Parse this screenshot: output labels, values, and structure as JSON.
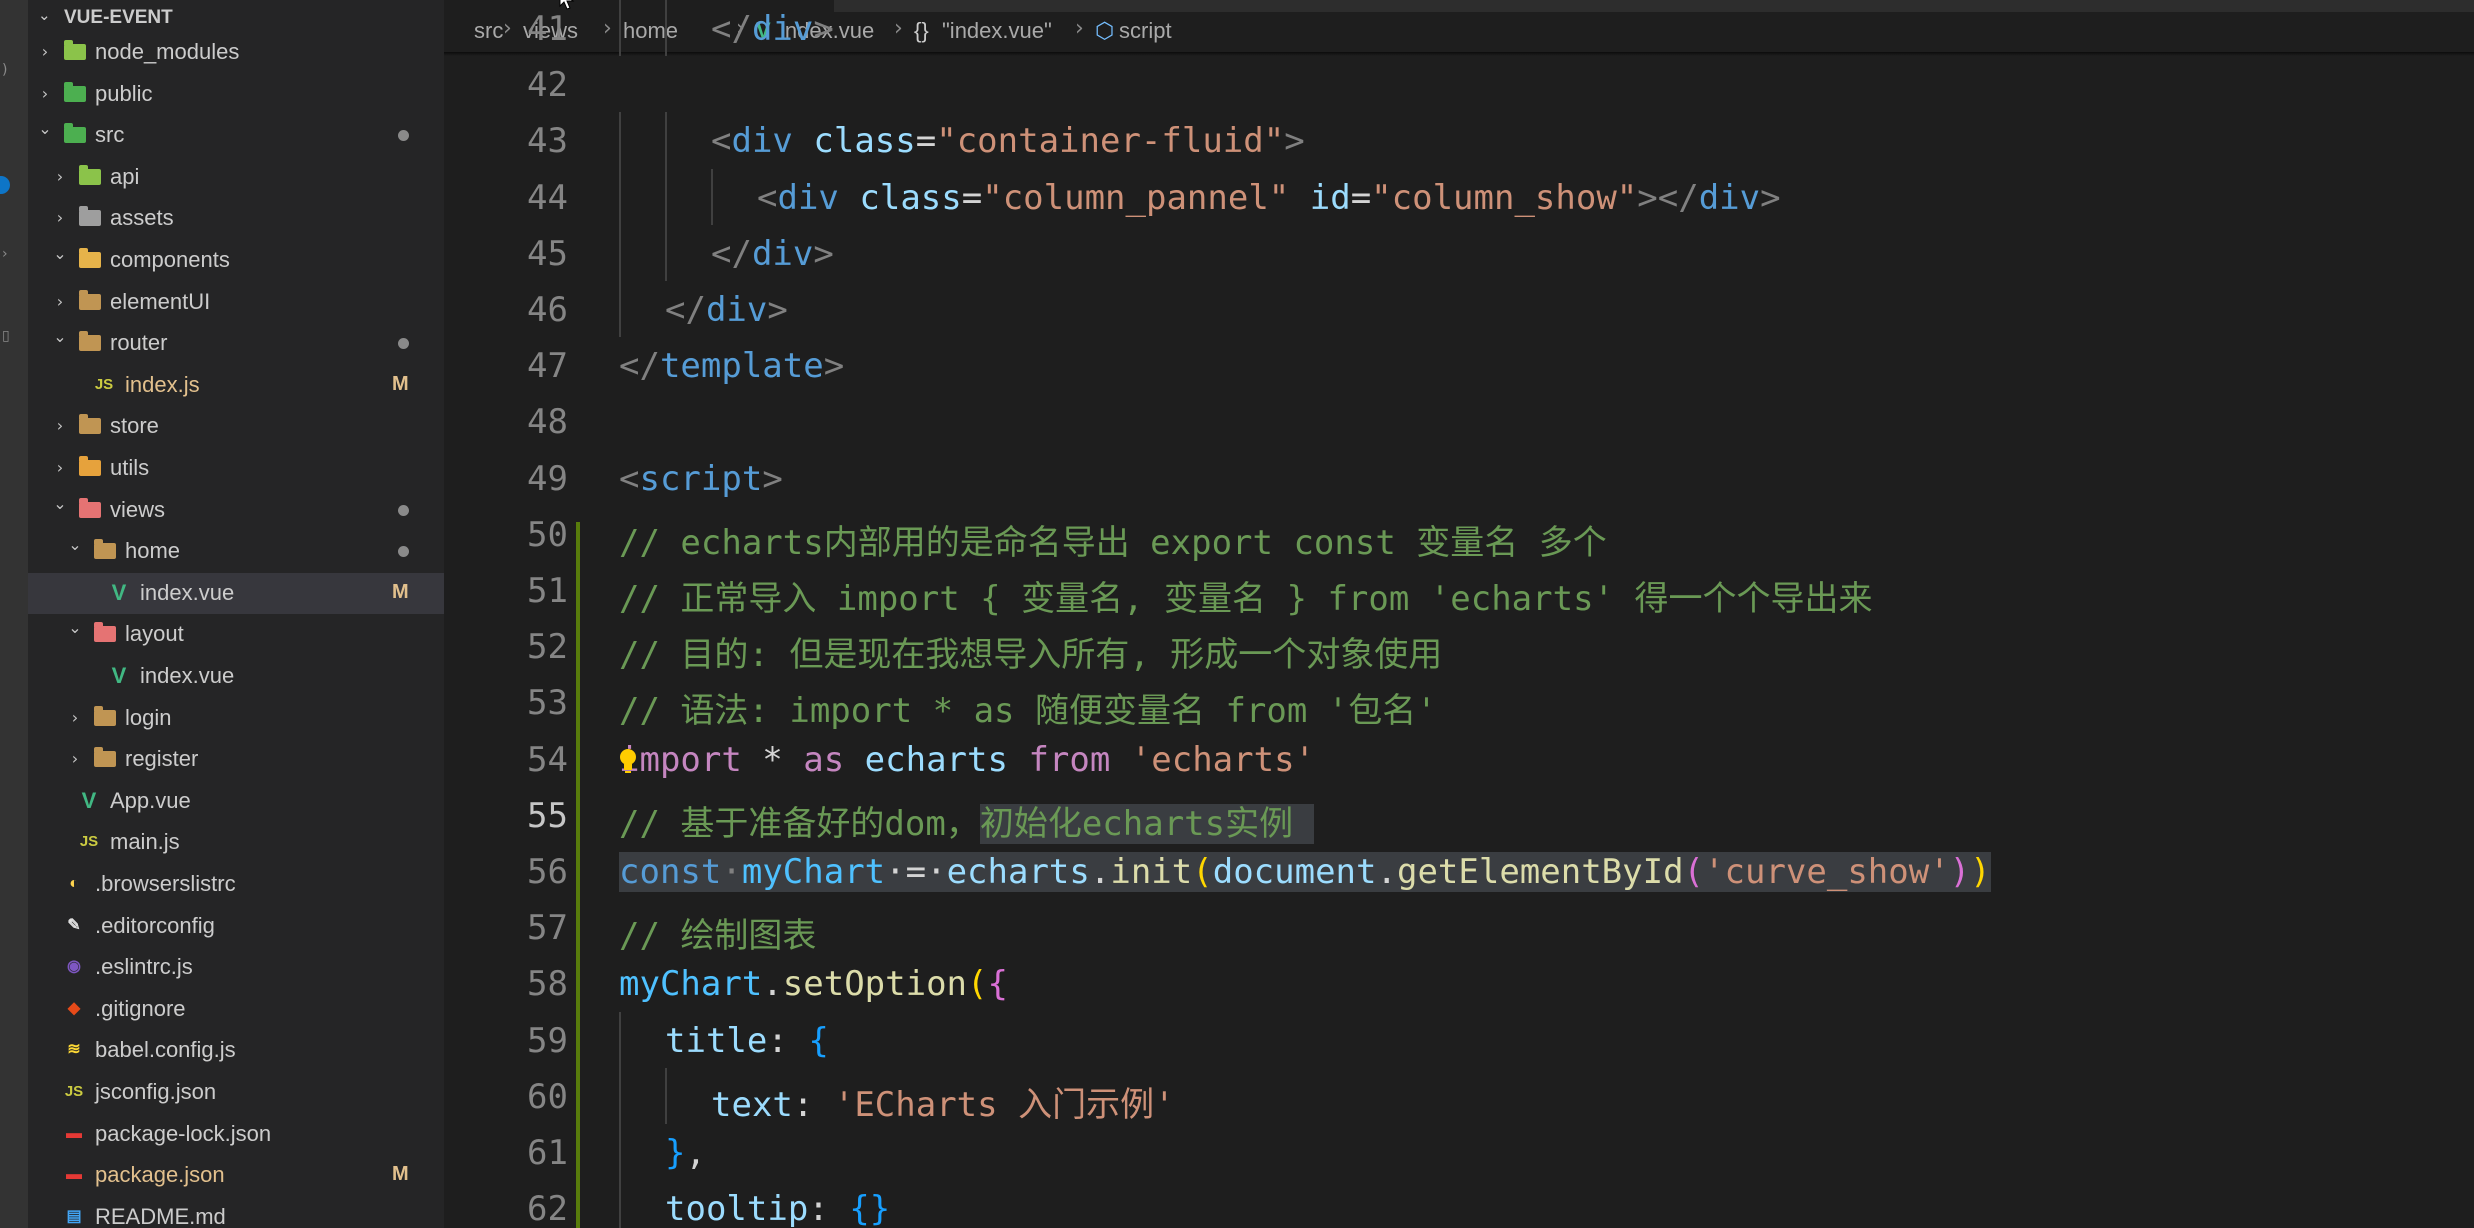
{
  "explorer": {
    "title": "VUE-EVENT",
    "items": [
      {
        "label": "node_modules",
        "depth": 1,
        "kind": "folder",
        "open": false,
        "icon": "node-folder-icon",
        "color": "#8bc34a"
      },
      {
        "label": "public",
        "depth": 1,
        "kind": "folder",
        "open": false,
        "icon": "public-folder-icon",
        "color": "#4caf50"
      },
      {
        "label": "src",
        "depth": 1,
        "kind": "folder",
        "open": true,
        "icon": "src-folder-icon",
        "color": "#4caf50",
        "badge": "dot"
      },
      {
        "label": "api",
        "depth": 2,
        "kind": "folder",
        "open": false,
        "icon": "api-folder-icon",
        "color": "#8bc34a"
      },
      {
        "label": "assets",
        "depth": 2,
        "kind": "folder",
        "open": false,
        "icon": "assets-folder-icon",
        "color": "#9e9e9e"
      },
      {
        "label": "components",
        "depth": 2,
        "kind": "folder",
        "open": true,
        "icon": "components-folder-icon",
        "color": "#e6b34a"
      },
      {
        "label": "elementUI",
        "depth": 2,
        "kind": "folder",
        "open": false,
        "icon": "folder-icon",
        "color": "#c09553"
      },
      {
        "label": "router",
        "depth": 2,
        "kind": "folder",
        "open": true,
        "icon": "router-folder-icon",
        "color": "#c09553",
        "badge": "dot"
      },
      {
        "label": "index.js",
        "depth": 3,
        "kind": "file",
        "icon": "js-file-icon",
        "glyph": "JS",
        "color": "#cbcb41",
        "badge": "M",
        "mod": true
      },
      {
        "label": "store",
        "depth": 2,
        "kind": "folder",
        "open": false,
        "icon": "folder-icon",
        "color": "#c09553"
      },
      {
        "label": "utils",
        "depth": 2,
        "kind": "folder",
        "open": false,
        "icon": "utils-folder-icon",
        "color": "#e6a23c"
      },
      {
        "label": "views",
        "depth": 2,
        "kind": "folder",
        "open": true,
        "icon": "views-folder-icon",
        "color": "#e57373",
        "badge": "dot"
      },
      {
        "label": "home",
        "depth": 3,
        "kind": "folder",
        "open": true,
        "icon": "folder-icon",
        "color": "#c09553",
        "badge": "dot"
      },
      {
        "label": "index.vue",
        "depth": 4,
        "kind": "file",
        "icon": "vue-file-icon",
        "glyph": "V",
        "color": "#41b883",
        "badge": "M",
        "selected": true
      },
      {
        "label": "layout",
        "depth": 3,
        "kind": "folder",
        "open": true,
        "icon": "layout-folder-icon",
        "color": "#e57373"
      },
      {
        "label": "index.vue",
        "depth": 4,
        "kind": "file",
        "icon": "vue-file-icon",
        "glyph": "V",
        "color": "#41b883"
      },
      {
        "label": "login",
        "depth": 3,
        "kind": "folder",
        "open": false,
        "icon": "folder-icon",
        "color": "#c09553"
      },
      {
        "label": "register",
        "depth": 3,
        "kind": "folder",
        "open": false,
        "icon": "folder-icon",
        "color": "#c09553"
      },
      {
        "label": "App.vue",
        "depth": 2,
        "kind": "file",
        "icon": "vue-file-icon",
        "glyph": "V",
        "color": "#41b883"
      },
      {
        "label": "main.js",
        "depth": 2,
        "kind": "file",
        "icon": "js-file-icon",
        "glyph": "JS",
        "color": "#cbcb41"
      },
      {
        "label": ".browserslistrc",
        "depth": 1,
        "kind": "file",
        "icon": "browserslist-file-icon",
        "glyph": "◐",
        "color": "#ffd54f"
      },
      {
        "label": ".editorconfig",
        "depth": 1,
        "kind": "file",
        "icon": "editorconfig-file-icon",
        "glyph": "✎",
        "color": "#e0e0e0"
      },
      {
        "label": ".eslintrc.js",
        "depth": 1,
        "kind": "file",
        "icon": "eslint-file-icon",
        "glyph": "◉",
        "color": "#7e57c2"
      },
      {
        "label": ".gitignore",
        "depth": 1,
        "kind": "file",
        "icon": "git-file-icon",
        "glyph": "◆",
        "color": "#e64a19"
      },
      {
        "label": "babel.config.js",
        "depth": 1,
        "kind": "file",
        "icon": "babel-file-icon",
        "glyph": "≋",
        "color": "#fdd835"
      },
      {
        "label": "jsconfig.json",
        "depth": 1,
        "kind": "file",
        "icon": "js-file-icon",
        "glyph": "JS",
        "color": "#cbcb41"
      },
      {
        "label": "package-lock.json",
        "depth": 1,
        "kind": "file",
        "icon": "npm-file-icon",
        "glyph": "▬",
        "color": "#e53935"
      },
      {
        "label": "package.json",
        "depth": 1,
        "kind": "file",
        "icon": "npm-file-icon",
        "glyph": "▬",
        "color": "#e53935",
        "badge": "M",
        "mod": true
      },
      {
        "label": "README.md",
        "depth": 1,
        "kind": "file",
        "icon": "readme-file-icon",
        "glyph": "▤",
        "color": "#42a5f5"
      }
    ]
  },
  "breadcrumb": {
    "items": [
      {
        "label": "src"
      },
      {
        "label": "views"
      },
      {
        "label": "home"
      },
      {
        "label": "index.vue",
        "icon": "vue-file-icon"
      },
      {
        "label": "\"index.vue\"",
        "icon": "braces-icon",
        "glyph": "{}"
      },
      {
        "label": "script",
        "icon": "cube-icon"
      }
    ]
  },
  "editor": {
    "first_line": 41,
    "active_line": 55,
    "lines": [
      {
        "n": "41",
        "indent": 2,
        "tokens": [
          {
            "t": "</",
            "c": "t-punc"
          },
          {
            "t": "div",
            "c": "t-tag"
          },
          {
            "t": ">",
            "c": "t-punc"
          }
        ]
      },
      {
        "n": "42",
        "indent": 0,
        "tokens": []
      },
      {
        "n": "43",
        "indent": 2,
        "tokens": [
          {
            "t": "<",
            "c": "t-punc"
          },
          {
            "t": "div",
            "c": "t-tag"
          },
          {
            "t": " class",
            "c": "t-attr"
          },
          {
            "t": "=",
            "c": "t-eq"
          },
          {
            "t": "\"container-fluid\"",
            "c": "t-str"
          },
          {
            "t": ">",
            "c": "t-punc"
          }
        ]
      },
      {
        "n": "44",
        "indent": 3,
        "tokens": [
          {
            "t": "<",
            "c": "t-punc"
          },
          {
            "t": "div",
            "c": "t-tag"
          },
          {
            "t": " class",
            "c": "t-attr"
          },
          {
            "t": "=",
            "c": "t-eq"
          },
          {
            "t": "\"column_pannel\"",
            "c": "t-str"
          },
          {
            "t": " id",
            "c": "t-attr"
          },
          {
            "t": "=",
            "c": "t-eq"
          },
          {
            "t": "\"column_show\"",
            "c": "t-str"
          },
          {
            "t": "></",
            "c": "t-punc"
          },
          {
            "t": "div",
            "c": "t-tag"
          },
          {
            "t": ">",
            "c": "t-punc"
          }
        ]
      },
      {
        "n": "45",
        "indent": 2,
        "tokens": [
          {
            "t": "</",
            "c": "t-punc"
          },
          {
            "t": "div",
            "c": "t-tag"
          },
          {
            "t": ">",
            "c": "t-punc"
          }
        ]
      },
      {
        "n": "46",
        "indent": 1,
        "tokens": [
          {
            "t": "</",
            "c": "t-punc"
          },
          {
            "t": "div",
            "c": "t-tag"
          },
          {
            "t": ">",
            "c": "t-punc"
          }
        ]
      },
      {
        "n": "47",
        "indent": 0,
        "tokens": [
          {
            "t": "</",
            "c": "t-punc"
          },
          {
            "t": "template",
            "c": "t-tag"
          },
          {
            "t": ">",
            "c": "t-punc"
          }
        ]
      },
      {
        "n": "48",
        "indent": 0,
        "tokens": []
      },
      {
        "n": "49",
        "indent": 0,
        "tokens": [
          {
            "t": "<",
            "c": "t-punc"
          },
          {
            "t": "script",
            "c": "t-tag"
          },
          {
            "t": ">",
            "c": "t-punc"
          }
        ]
      },
      {
        "n": "50",
        "indent": 0,
        "tokens": [
          {
            "t": "// echarts内部用的是命名导出 export const 变量名 多个",
            "c": "t-com"
          }
        ]
      },
      {
        "n": "51",
        "indent": 0,
        "tokens": [
          {
            "t": "// 正常导入 import { 变量名, 变量名 } from 'echarts' 得一个个导出来",
            "c": "t-com"
          }
        ]
      },
      {
        "n": "52",
        "indent": 0,
        "tokens": [
          {
            "t": "// 目的: 但是现在我想导入所有, 形成一个对象使用",
            "c": "t-com"
          }
        ]
      },
      {
        "n": "53",
        "indent": 0,
        "tokens": [
          {
            "t": "// 语法: import * as 随便变量名 from '包名'",
            "c": "t-com"
          }
        ]
      },
      {
        "n": "54",
        "indent": 0,
        "tokens": [
          {
            "t": "import",
            "c": "t-kw"
          },
          {
            "t": " * ",
            "c": "t-eq"
          },
          {
            "t": "as",
            "c": "t-kw"
          },
          {
            "t": " echarts ",
            "c": "t-prop"
          },
          {
            "t": "from",
            "c": "t-kw"
          },
          {
            "t": " 'echarts'",
            "c": "t-str"
          }
        ]
      },
      {
        "n": "55",
        "indent": 0,
        "tokens": [
          {
            "t": "// 基于准备好的dom，",
            "c": "t-com"
          },
          {
            "t": "初始化echarts实例 ",
            "c": "t-com sel-hl"
          }
        ]
      },
      {
        "n": "56",
        "indent": 0,
        "tokens": [
          {
            "t": "const",
            "c": "t-const sel-hl"
          },
          {
            "t": "·",
            "c": "t-punc sel-hl"
          },
          {
            "t": "myChart",
            "c": "t-var sel-hl"
          },
          {
            "t": "·=·",
            "c": "t-eq sel-hl"
          },
          {
            "t": "echarts",
            "c": "t-prop sel-hl"
          },
          {
            "t": ".",
            "c": "t-eq sel-hl"
          },
          {
            "t": "init",
            "c": "t-fn sel-hl"
          },
          {
            "t": "(",
            "c": "t-br1 sel-hl"
          },
          {
            "t": "document",
            "c": "t-prop sel-hl"
          },
          {
            "t": ".",
            "c": "t-eq sel-hl"
          },
          {
            "t": "getElementById",
            "c": "t-fn sel-hl"
          },
          {
            "t": "(",
            "c": "t-br2 sel-hl"
          },
          {
            "t": "'curve_show'",
            "c": "t-str sel-hl"
          },
          {
            "t": ")",
            "c": "t-br2 sel-hl"
          },
          {
            "t": ")",
            "c": "t-br1 sel-hl"
          }
        ]
      },
      {
        "n": "57",
        "indent": 0,
        "tokens": [
          {
            "t": "// 绘制图表",
            "c": "t-com"
          }
        ]
      },
      {
        "n": "58",
        "indent": 0,
        "tokens": [
          {
            "t": "myChart",
            "c": "t-var"
          },
          {
            "t": ".",
            "c": "t-eq"
          },
          {
            "t": "setOption",
            "c": "t-fn"
          },
          {
            "t": "(",
            "c": "t-br1"
          },
          {
            "t": "{",
            "c": "t-br2"
          }
        ]
      },
      {
        "n": "59",
        "indent": 1,
        "tokens": [
          {
            "t": "title",
            "c": "t-prop"
          },
          {
            "t": ": ",
            "c": "t-eq"
          },
          {
            "t": "{",
            "c": "t-br3"
          }
        ]
      },
      {
        "n": "60",
        "indent": 2,
        "tokens": [
          {
            "t": "text",
            "c": "t-prop"
          },
          {
            "t": ": ",
            "c": "t-eq"
          },
          {
            "t": "'ECharts 入门示例'",
            "c": "t-str"
          }
        ]
      },
      {
        "n": "61",
        "indent": 1,
        "tokens": [
          {
            "t": "}",
            "c": "t-br3"
          },
          {
            "t": ",",
            "c": "t-eq"
          }
        ]
      },
      {
        "n": "62",
        "indent": 1,
        "tokens": [
          {
            "t": "tooltip",
            "c": "t-prop"
          },
          {
            "t": ": ",
            "c": "t-eq"
          },
          {
            "t": "{}",
            "c": "t-br3"
          }
        ]
      }
    ]
  }
}
